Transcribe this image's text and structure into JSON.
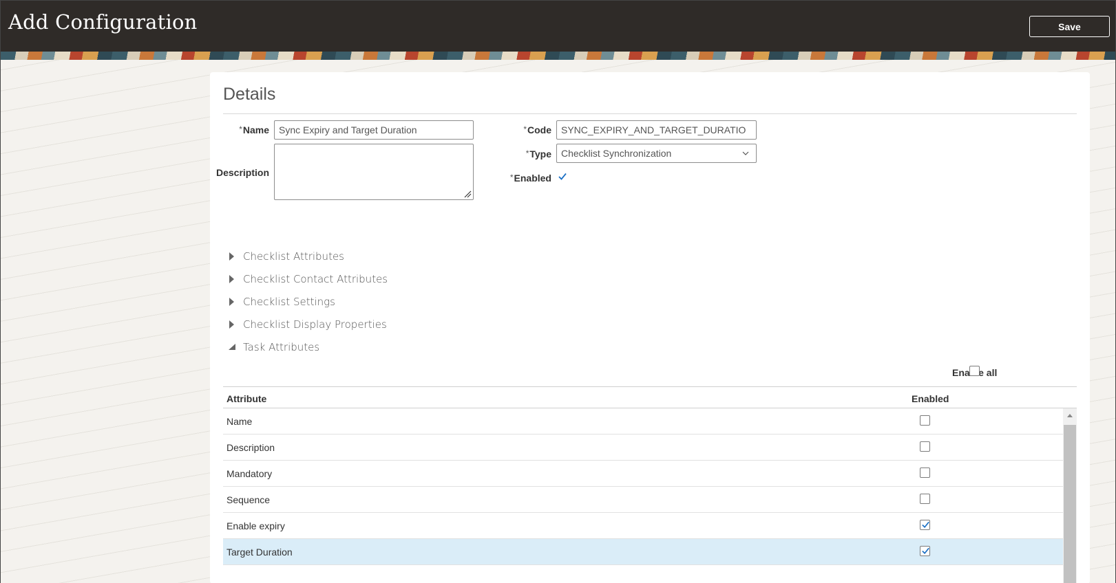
{
  "header": {
    "title": "Add Configuration",
    "save_label": "Save"
  },
  "details": {
    "section_title": "Details",
    "required_marker": "*",
    "name_label": "Name",
    "name_value": "Sync Expiry and Target Duration",
    "description_label": "Description",
    "description_value": "",
    "code_label": "Code",
    "code_value": "SYNC_EXPIRY_AND_TARGET_DURATIO",
    "type_label": "Type",
    "type_value": "Checklist Synchronization",
    "enabled_label": "Enabled",
    "enabled_checked": true
  },
  "sections": [
    {
      "label": "Checklist Attributes",
      "expanded": false
    },
    {
      "label": "Checklist Contact Attributes",
      "expanded": false
    },
    {
      "label": "Checklist Settings",
      "expanded": false
    },
    {
      "label": "Checklist Display Properties",
      "expanded": false
    },
    {
      "label": "Task Attributes",
      "expanded": true
    }
  ],
  "task_attributes": {
    "enable_all_label": "Enable all",
    "enable_all_checked": false,
    "columns": [
      "Attribute",
      "Enabled"
    ],
    "rows": [
      {
        "attribute": "Name",
        "enabled": false,
        "selected": false
      },
      {
        "attribute": "Description",
        "enabled": false,
        "selected": false
      },
      {
        "attribute": "Mandatory",
        "enabled": false,
        "selected": false
      },
      {
        "attribute": "Sequence",
        "enabled": false,
        "selected": false
      },
      {
        "attribute": "Enable expiry",
        "enabled": true,
        "selected": false
      },
      {
        "attribute": "Target Duration",
        "enabled": true,
        "selected": true
      }
    ]
  },
  "colors": {
    "header_bg": "#2f2b28",
    "check_color": "#1a6fc4",
    "selected_row": "#daedf8"
  }
}
